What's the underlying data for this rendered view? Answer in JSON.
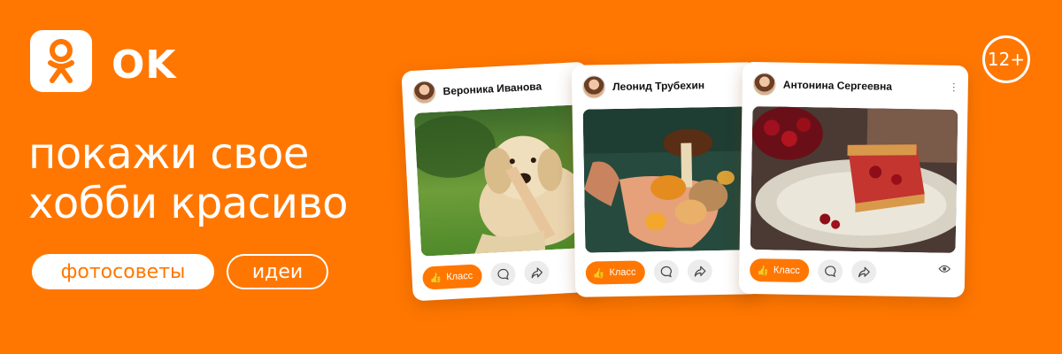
{
  "brand": {
    "logo_text": "OK",
    "age_rating": "12+"
  },
  "headline": {
    "line1": "покажи свое",
    "line2": "хобби красиво"
  },
  "pills": {
    "primary": "фотосоветы",
    "secondary": "идеи"
  },
  "cards": [
    {
      "author": "Вероника Иванова",
      "like_label": "Класс",
      "photo": "dog-photo"
    },
    {
      "author": "Леонид Трубехин",
      "like_label": "Класс",
      "photo": "mushrooms-photo"
    },
    {
      "author": "Антонина Сергеевна",
      "like_label": "Класс",
      "photo": "cherry-pie-photo"
    }
  ],
  "colors": {
    "brand_orange": "#FF7700",
    "white": "#FFFFFF"
  }
}
